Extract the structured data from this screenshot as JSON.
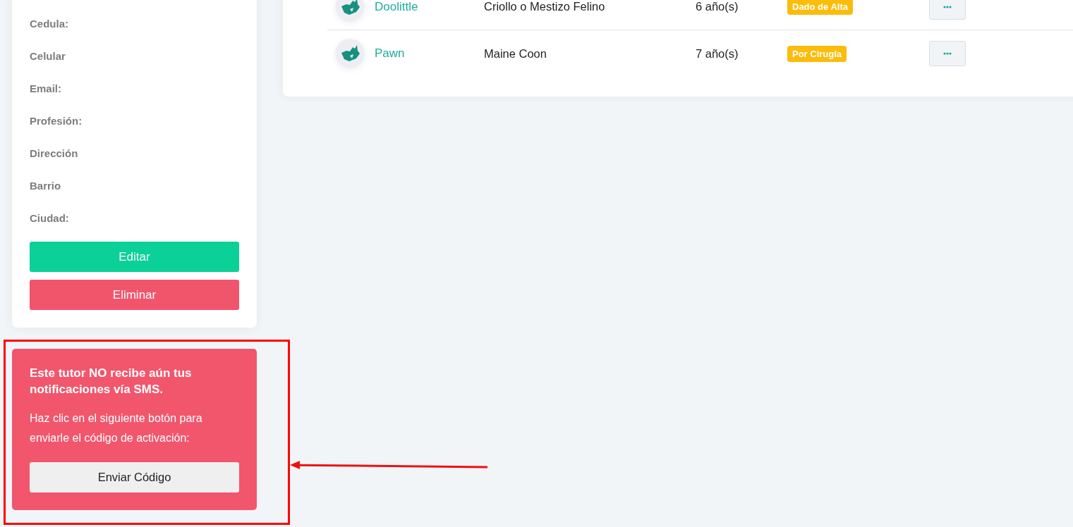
{
  "client_card": {
    "fields": [
      "Cedula:",
      "Celular",
      "Email:",
      "Profesión:",
      "Dirección",
      "Barrio",
      "Ciudad:"
    ],
    "buttons": [
      {
        "label": "Editar",
        "kind": "primary"
      },
      {
        "label": "Eliminar",
        "kind": "danger"
      }
    ]
  },
  "sms_alert": {
    "title": "Este tutor NO recibe aún tus notificaciones vía SMS.",
    "message": "Haz clic en el siguiente botón para enviarle el código de activación:",
    "button": "Enviar Código"
  },
  "pets_table": {
    "rows": [
      {
        "name": "Doolittle",
        "breed": "Criollo o Mestizo Felino",
        "age": "6 año(s)",
        "status": "Dado de Alta"
      },
      {
        "name": "Pawn",
        "breed": "Maine Coon",
        "age": "7 año(s)",
        "status": "Por Cirugía"
      }
    ]
  }
}
